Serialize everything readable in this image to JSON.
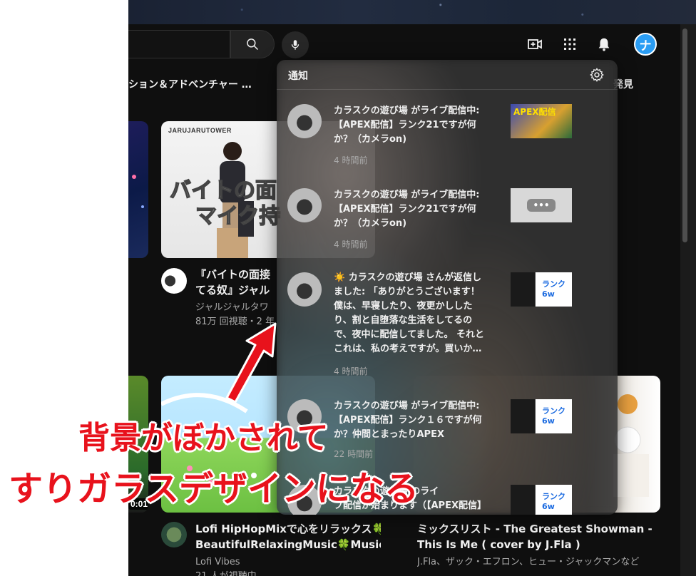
{
  "header": {
    "chips": [
      "ション＆アドベンチャー …",
      "発見"
    ]
  },
  "videos": [
    {
      "thumb_brand": "JARUJARUTOWER",
      "thumb_line1": "バイトの面",
      "thumb_line2": "マイク持",
      "title_line1": "『バイトの面接",
      "title_line2": "てる奴』ジャル",
      "channel": "ジャルジャルタワ",
      "meta": "81万 回視聴・2 年"
    },
    {
      "duration": "0:01"
    },
    {
      "title_line1": "Lofi HipHopMixで心をリラックス🍀",
      "title_line2": "BeautifulRelaxingMusic🍀Musicで…",
      "channel": "Lofi Vibes",
      "meta": "21 人が視聴中"
    },
    {
      "title_line1": "ミックスリスト - The Greatest Showman -",
      "title_line2": "This Is Me ( cover by J.Fla )",
      "meta": "J.Fla、ザック・エフロン、ヒュー・ジャックマンなど"
    }
  ],
  "notifications": {
    "title": "通知",
    "items": [
      {
        "text": "カラスクの遊び場 がライブ配信中:\n【APEX配信】ランク21ですが何\nか？（カメラon)",
        "time": "4 時間前",
        "thumb_text": "APEX配信"
      },
      {
        "text": "カラスクの遊び場 がライブ配信中:\n【APEX配信】ランク21ですが何\nか？（カメラon)",
        "time": "4 時間前",
        "thumb_text": "•••"
      },
      {
        "text": "☀️ カラスクの遊び場 さんが返信し\nました: 「ありがとうございます！\n僕は、早寝したり、夜更かしした\nり、割と自堕落な生活をしてるの\nで、夜中に配信してました。 それと\nこれは、私の考えですが。買いか…",
        "time": "4 時間前",
        "thumb_text": "ランク6w"
      },
      {
        "text": "カラスクの遊び場 がライブ配信中:\n【APEX配信】ランク１６ですが何\nか？仲間とまったりAPEX",
        "time": "22 時間前",
        "thumb_text": "ランク6w"
      },
      {
        "text": "カラスクの遊び場 のライ\nブ配信が始まります（【APEX配信】",
        "time": "",
        "thumb_text": "ランク6w"
      }
    ]
  },
  "annotation": {
    "line1": "背景がぼかされて",
    "line2": "すりガラスデザインになる"
  },
  "colors": {
    "annotation": "#e8121c",
    "avatar": "#2a9df4"
  }
}
